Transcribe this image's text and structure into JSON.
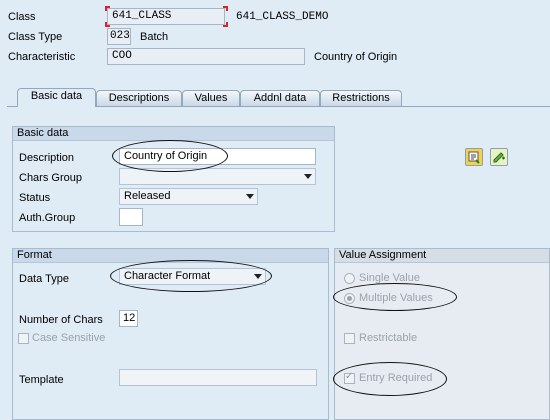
{
  "header": {
    "class_label": "Class",
    "class_value": "641_CLASS",
    "class_desc": "641_CLASS_DEMO",
    "class_type_label": "Class Type",
    "class_type_value": "023",
    "class_type_desc": "Batch",
    "characteristic_label": "Characteristic",
    "characteristic_value": "COO",
    "characteristic_desc": "Country of Origin"
  },
  "tabs": [
    {
      "label": "Basic data",
      "active": true
    },
    {
      "label": "Descriptions",
      "active": false
    },
    {
      "label": "Values",
      "active": false
    },
    {
      "label": "Addnl data",
      "active": false
    },
    {
      "label": "Restrictions",
      "active": false
    }
  ],
  "basic_data": {
    "title": "Basic data",
    "description_label": "Description",
    "description_value": "Country of Origin",
    "chars_group_label": "Chars Group",
    "chars_group_value": "",
    "status_label": "Status",
    "status_value": "Released",
    "auth_group_label": "Auth.Group",
    "auth_group_value": ""
  },
  "format": {
    "title": "Format",
    "data_type_label": "Data Type",
    "data_type_value": "Character Format",
    "num_chars_label": "Number of Chars",
    "num_chars_value": "12",
    "case_sensitive_label": "Case Sensitive",
    "case_sensitive_checked": false,
    "template_label": "Template",
    "template_value": ""
  },
  "value_assignment": {
    "title": "Value Assignment",
    "single_value_label": "Single Value",
    "multiple_values_label": "Multiple Values",
    "selected": "Multiple Values",
    "restrictable_label": "Restrictable",
    "restrictable_checked": false,
    "entry_required_label": "Entry Required",
    "entry_required_checked": true
  },
  "icons": [
    "other-language-icon",
    "change-icon"
  ],
  "colors": {
    "background": "#dfebf5",
    "group_header": "#c9d9ea",
    "focus_corner": "#e0202a"
  }
}
